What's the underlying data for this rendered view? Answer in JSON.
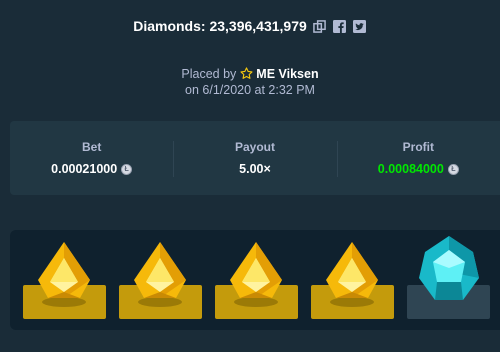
{
  "header": {
    "title": "Diamonds: 23,396,431,979",
    "icons": [
      "copy-icon",
      "facebook-icon",
      "twitter-icon"
    ]
  },
  "placed": {
    "prefix": "Placed by",
    "user": "ME Viksen",
    "date": "on 6/1/2020 at 2:32 PM"
  },
  "stats": {
    "bet": {
      "label": "Bet",
      "value": "0.00021000",
      "currency_icon": "litecoin-icon"
    },
    "payout": {
      "label": "Payout",
      "value": "5.00×"
    },
    "profit": {
      "label": "Profit",
      "value": "0.00084000",
      "currency_icon": "litecoin-icon"
    }
  },
  "board": {
    "gems": [
      {
        "type": "yellow-gem",
        "color": "#f6c90e"
      },
      {
        "type": "yellow-gem",
        "color": "#f6c90e"
      },
      {
        "type": "yellow-gem",
        "color": "#f6c90e"
      },
      {
        "type": "yellow-gem",
        "color": "#f6c90e"
      },
      {
        "type": "blue-gem",
        "color": "#1fd1e0"
      }
    ]
  },
  "colors": {
    "background": "#1a2c38",
    "panel": "#213743",
    "profit_green": "#00e701",
    "gold_tile": "#c49b0c"
  }
}
